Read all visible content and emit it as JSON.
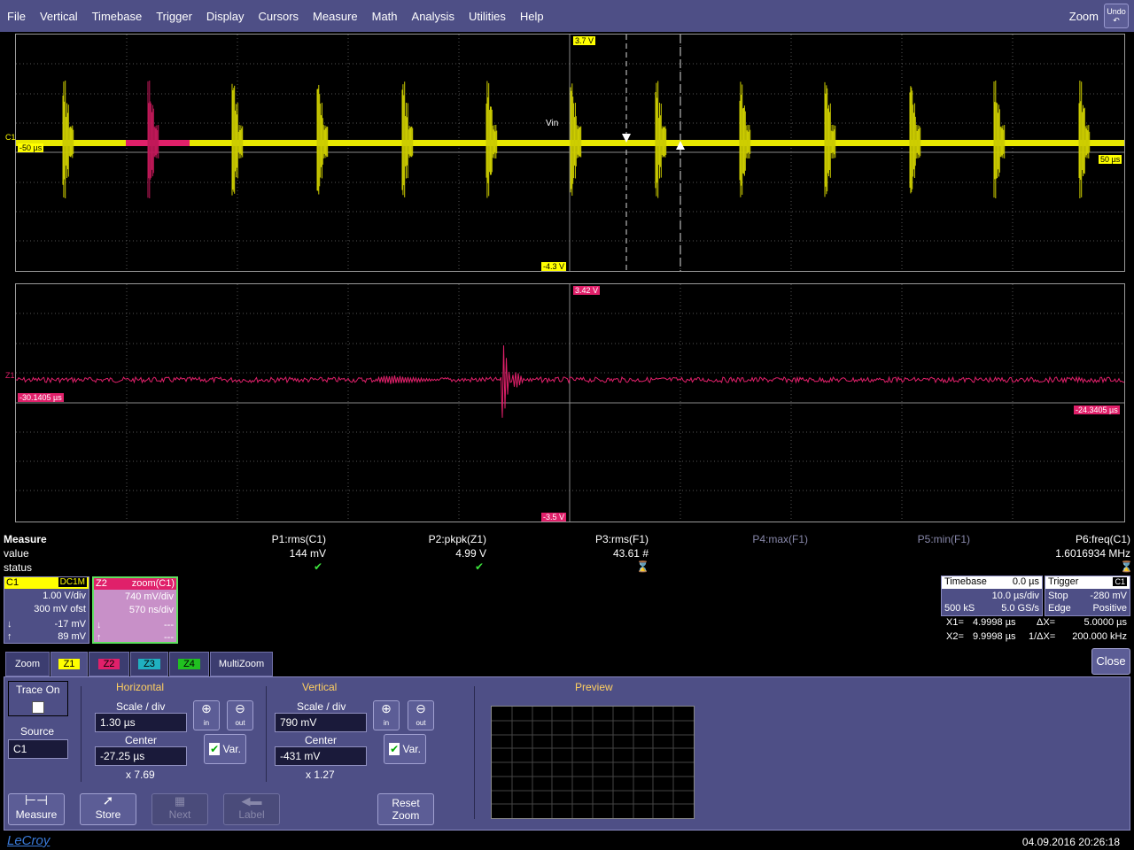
{
  "menu": [
    "File",
    "Vertical",
    "Timebase",
    "Trigger",
    "Display",
    "Cursors",
    "Measure",
    "Math",
    "Analysis",
    "Utilities",
    "Help"
  ],
  "menu_right": {
    "zoom_label": "Zoom",
    "undo_label": "Undo"
  },
  "grid1": {
    "top_label": "3.7 V",
    "bottom_label": "-4.3 V",
    "left_time": "-50 µs",
    "right_time": "50 µs",
    "channel_marker": "C1",
    "trace_label": "Vin"
  },
  "grid2": {
    "top_label": "3.42 V",
    "bottom_label": "-3.5 V",
    "left_time": "-30.1405 µs",
    "right_time": "-24.3405 µs",
    "channel_marker": "Z1"
  },
  "measure": {
    "row_labels": {
      "title": "Measure",
      "value": "value",
      "status": "status"
    },
    "params": [
      {
        "name": "P1:rms(C1)",
        "value": "144 mV",
        "status": "ok"
      },
      {
        "name": "P2:pkpk(Z1)",
        "value": "4.99 V",
        "status": "ok"
      },
      {
        "name": "P3:rms(F1)",
        "value": "43.61 #",
        "status": "warn"
      },
      {
        "name": "P4:max(F1)",
        "value": "",
        "status": ""
      },
      {
        "name": "P5:min(F1)",
        "value": "",
        "status": ""
      },
      {
        "name": "P6:freq(C1)",
        "value": "1.6016934 MHz",
        "status": "warn"
      }
    ]
  },
  "c1": {
    "name": "C1",
    "coupling": "DC1M",
    "vdiv": "1.00 V/div",
    "offset": "300 mV ofst",
    "v1": "-17 mV",
    "v2": "89 mV"
  },
  "z2": {
    "name": "Z2",
    "source": "zoom(C1)",
    "vdiv": "740 mV/div",
    "tdiv": "570 ns/div",
    "v1": "---",
    "v2": "---"
  },
  "timebase": {
    "label": "Timebase",
    "delay": "0.0 µs",
    "tdiv": "10.0 µs/div",
    "samples": "500 kS",
    "rate": "5.0 GS/s"
  },
  "trigger": {
    "label": "Trigger",
    "source": "C1",
    "mode": "Stop",
    "level": "-280 mV",
    "type": "Edge",
    "slope": "Positive"
  },
  "cursors": {
    "x1": "X1=",
    "x1v": "4.9998 µs",
    "dx": "ΔX=",
    "dxv": "5.0000 µs",
    "x2": "X2=",
    "x2v": "9.9998 µs",
    "idx": "1/ΔX=",
    "idxv": "200.000 kHz"
  },
  "tabs": [
    "Zoom",
    "Z1",
    "Z2",
    "Z3",
    "Z4",
    "MultiZoom"
  ],
  "close_label": "Close",
  "dialog": {
    "trace_on": "Trace On",
    "source_label": "Source",
    "source_value": "C1",
    "horizontal": "Horizontal",
    "vertical": "Vertical",
    "preview": "Preview",
    "scale_label": "Scale / div",
    "center_label": "Center",
    "h_scale": "1.30 µs",
    "h_center": "-27.25 µs",
    "h_factor": "x 7.69",
    "v_scale": "790 mV",
    "v_center": "-431 mV",
    "v_factor": "x 1.27",
    "in": "in",
    "out": "out",
    "var": "Var.",
    "reset_zoom_1": "Reset",
    "reset_zoom_2": "Zoom"
  },
  "bottom_buttons": {
    "measure": "Measure",
    "store": "Store",
    "next": "Next",
    "label": "Label"
  },
  "footer": {
    "brand": "LeCroy",
    "datetime": "04.09.2016 20:26:18"
  },
  "colors": {
    "menubar": "#4e4f86",
    "c1": "#ffff00",
    "z": "#e0206a",
    "dialog": "#4e4f86"
  }
}
